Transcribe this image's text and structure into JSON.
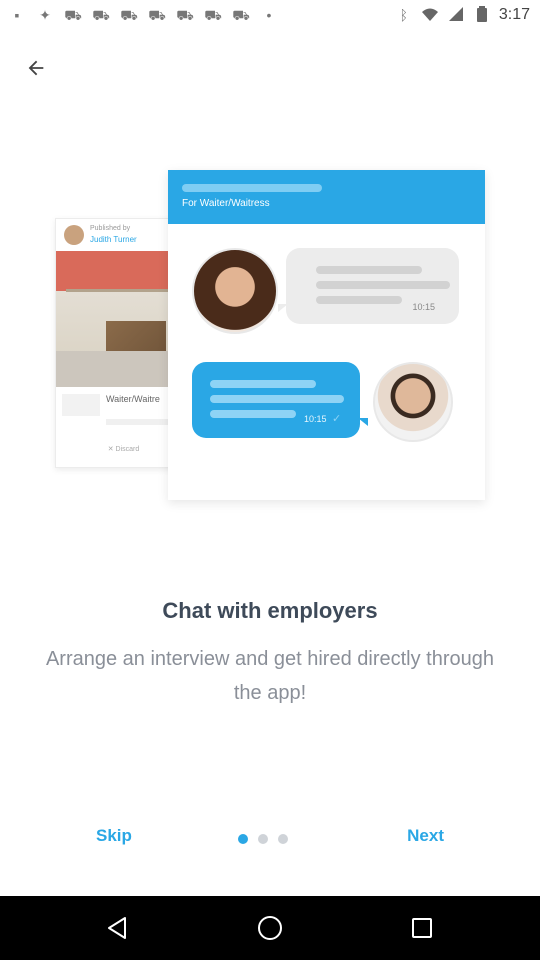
{
  "status_bar": {
    "time": "3:17",
    "left_icons": [
      "notification-icon",
      "settings-icon",
      "car-icon",
      "car-icon",
      "car-icon",
      "car-icon",
      "car-icon",
      "car-icon",
      "car-icon",
      "dot-icon"
    ],
    "right_icons": [
      "bluetooth-icon",
      "wifi-icon",
      "signal-icon",
      "battery-icon"
    ]
  },
  "illustration": {
    "left_card": {
      "published_by": "Published by",
      "publisher_name": "Judith Turner",
      "job_title": "Waiter/Waitre",
      "discard": "✕ Discard"
    },
    "main_card": {
      "header_title": "For Waiter/Waitress",
      "received_time": "10:15",
      "sent_time": "10:15"
    }
  },
  "onboarding": {
    "title": "Chat with employers",
    "description": "Arrange an interview and get hired directly through the app!",
    "page_count": 3,
    "current_page": 1
  },
  "actions": {
    "skip_label": "Skip",
    "next_label": "Next"
  },
  "colors": {
    "accent": "#2aa7e5",
    "title": "#3e4a59",
    "description": "#8a8f98"
  }
}
